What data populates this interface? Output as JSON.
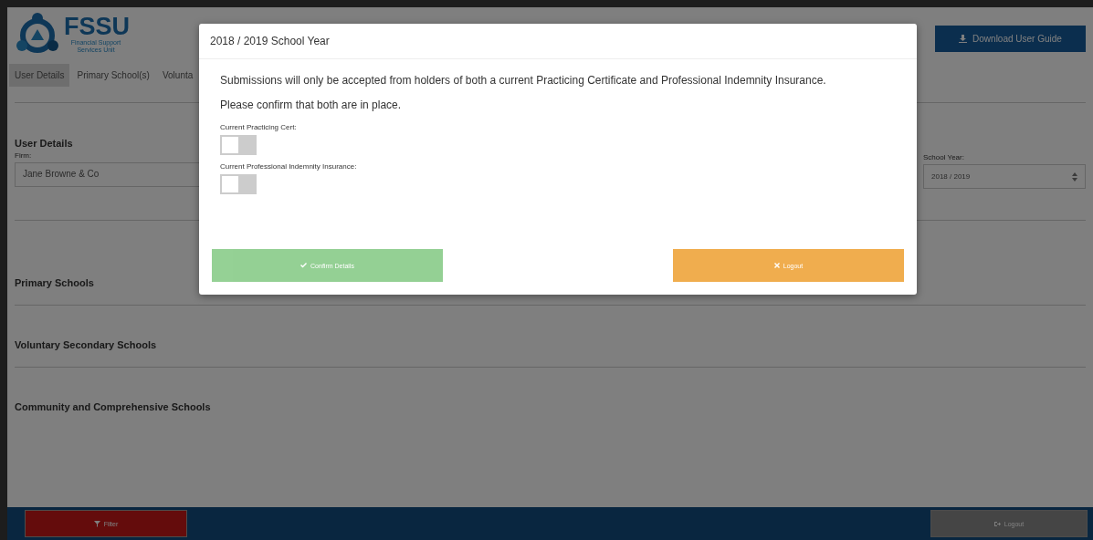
{
  "header": {
    "logo_title": "FSSU",
    "logo_subtitle": "Financial Support Services Unit",
    "download_button": "Download User Guide"
  },
  "tabs": [
    {
      "label": "User Details",
      "selected": true
    },
    {
      "label": "Primary School(s)",
      "selected": false
    },
    {
      "label": "Volunta",
      "selected": false
    }
  ],
  "user_details": {
    "heading": "User Details",
    "firm_label": "Firm:",
    "firm_value": "Jane Browne & Co",
    "school_year_label": "School Year:",
    "school_year_value": "2018 / 2019"
  },
  "sections": [
    "Primary Schools",
    "Voluntary Secondary Schools",
    "Community and Comprehensive Schools"
  ],
  "footer": {
    "filter_button": "Filter",
    "logout_button": "Logout"
  },
  "modal": {
    "title": "2018 / 2019 School Year",
    "message": "Submissions will only be accepted from holders of both a current Practicing Certificate and Professional Indemnity Insurance.",
    "prompt": "Please confirm that both are in place.",
    "toggles": [
      {
        "label": "Current Practicing Cert:",
        "on": false
      },
      {
        "label": "Current Professional Indemnity Insurance:",
        "on": false
      }
    ],
    "confirm_button": {
      "label": "Confirm Details",
      "disabled": true
    },
    "logout_button": {
      "label": "Logout",
      "disabled": false
    }
  }
}
